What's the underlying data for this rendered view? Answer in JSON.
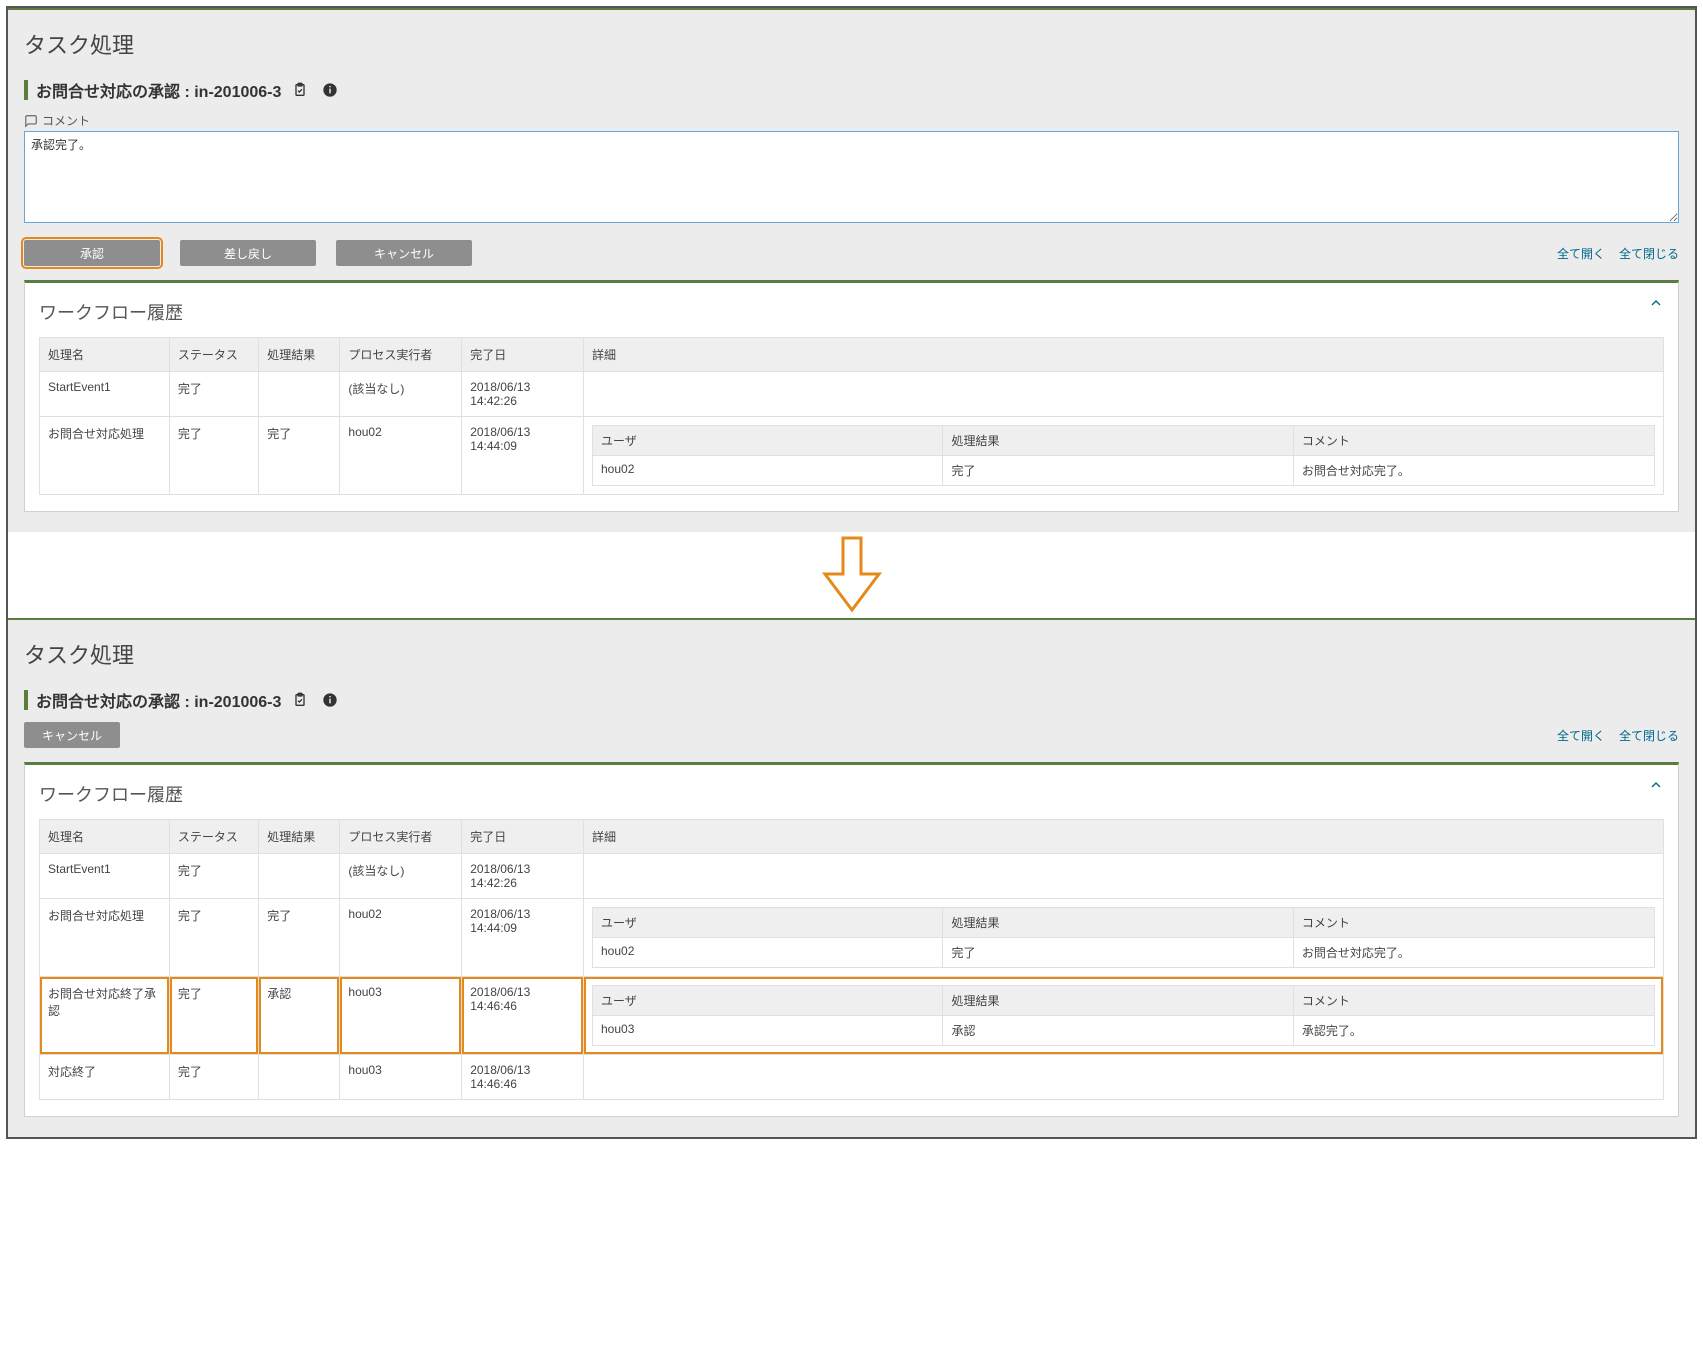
{
  "common": {
    "page_title": "タスク処理",
    "sub_title": "お問合せ対応の承認 : in-201006-3",
    "open_all": "全て開く",
    "close_all": "全て閉じる",
    "history_title": "ワークフロー履歴",
    "cols": {
      "name": "処理名",
      "status": "ステータス",
      "result": "処理結果",
      "exec": "プロセス実行者",
      "date": "完了日",
      "detail": "詳細"
    },
    "detail_cols": {
      "user": "ユーザ",
      "result": "処理結果",
      "comment": "コメント"
    }
  },
  "top": {
    "comment_label": "コメント",
    "comment_value": "承認完了。",
    "approve": "承認",
    "reject": "差し戻し",
    "cancel": "キャンセル",
    "history_rows": [
      {
        "name": "StartEvent1",
        "status": "完了",
        "result": "",
        "exec": "(該当なし)",
        "date": "2018/06/13 14:42:26",
        "details": []
      },
      {
        "name": "お問合せ対応処理",
        "status": "完了",
        "result": "完了",
        "exec": "hou02",
        "date": "2018/06/13 14:44:09",
        "details": [
          {
            "user": "hou02",
            "result": "完了",
            "comment": "お問合せ対応完了。"
          }
        ]
      }
    ]
  },
  "bottom": {
    "cancel": "キャンセル",
    "history_rows": [
      {
        "name": "StartEvent1",
        "status": "完了",
        "result": "",
        "exec": "(該当なし)",
        "date": "2018/06/13 14:42:26",
        "details": [],
        "highlight": false
      },
      {
        "name": "お問合せ対応処理",
        "status": "完了",
        "result": "完了",
        "exec": "hou02",
        "date": "2018/06/13 14:44:09",
        "details": [
          {
            "user": "hou02",
            "result": "完了",
            "comment": "お問合せ対応完了。"
          }
        ],
        "highlight": false
      },
      {
        "name": "お問合せ対応終了承認",
        "status": "完了",
        "result": "承認",
        "exec": "hou03",
        "date": "2018/06/13 14:46:46",
        "details": [
          {
            "user": "hou03",
            "result": "承認",
            "comment": "承認完了。"
          }
        ],
        "highlight": true
      },
      {
        "name": "対応終了",
        "status": "完了",
        "result": "",
        "exec": "hou03",
        "date": "2018/06/13 14:46:46",
        "details": [],
        "highlight": false
      }
    ]
  }
}
